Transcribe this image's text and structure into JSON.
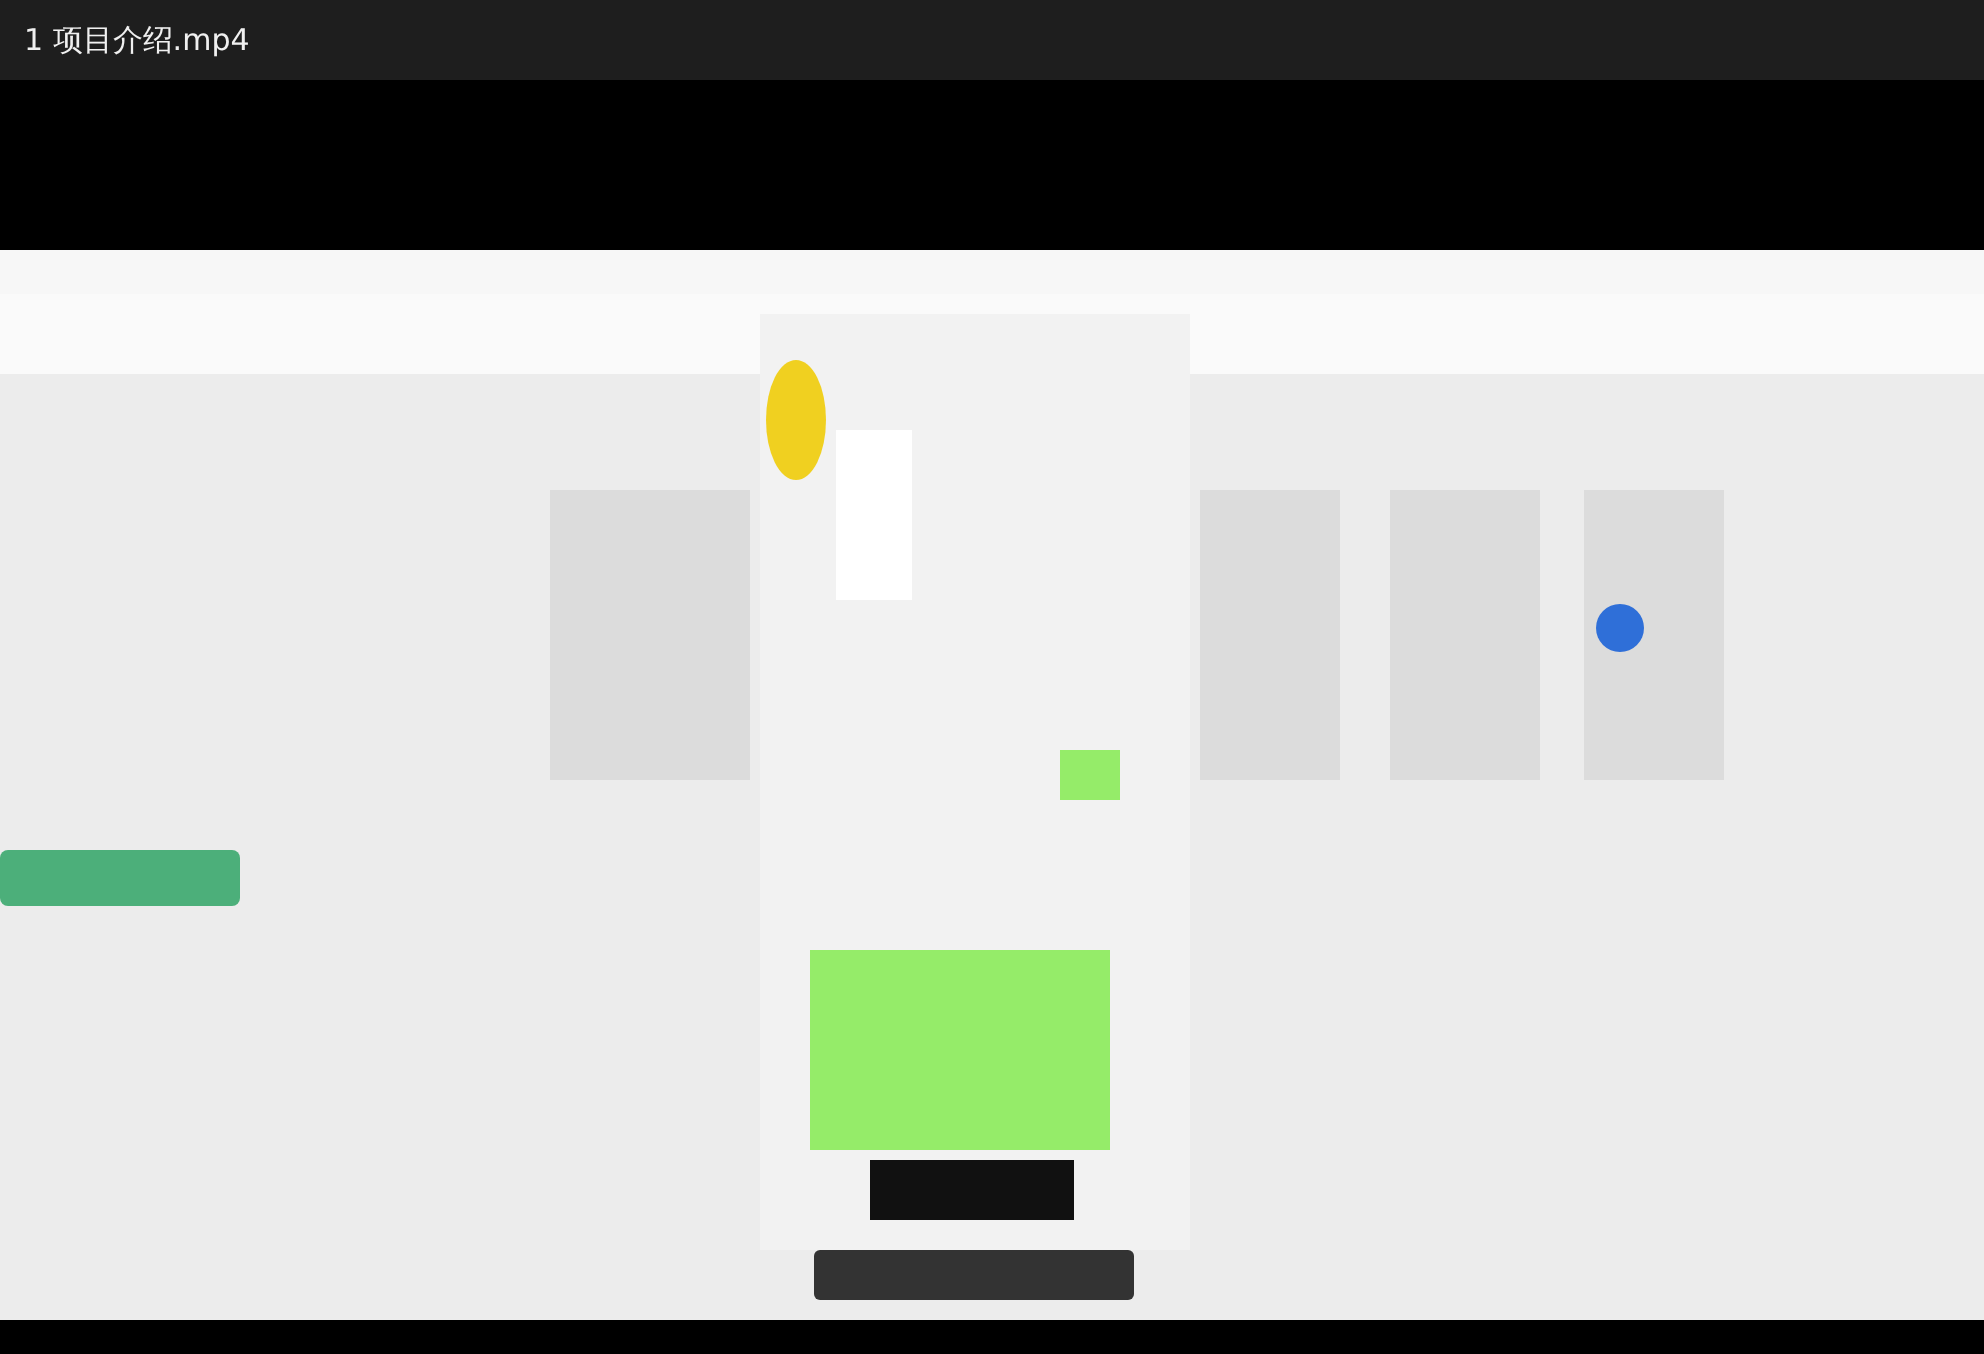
{
  "window": {
    "title": "1 项目介绍.mp4"
  }
}
